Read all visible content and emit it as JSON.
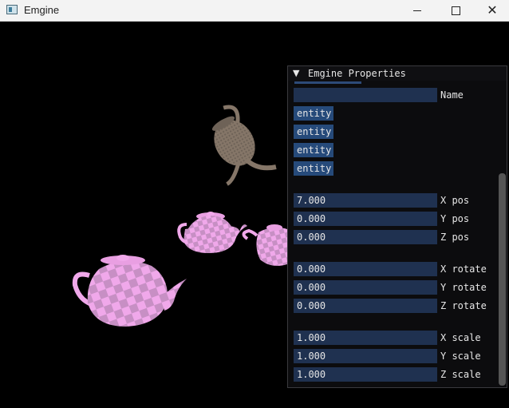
{
  "window": {
    "title": "Emgine"
  },
  "panel": {
    "title": "Emgine Properties",
    "name_label": "Name",
    "name_value": "",
    "entities": [
      "entity",
      "entity",
      "entity",
      "entity"
    ],
    "transforms": [
      {
        "label": "X pos",
        "value": "7.000"
      },
      {
        "label": "Y pos",
        "value": "0.000"
      },
      {
        "label": "Z pos",
        "value": "0.000"
      },
      {
        "label": "X rotate",
        "value": "0.000"
      },
      {
        "label": "Y rotate",
        "value": "0.000"
      },
      {
        "label": "Z rotate",
        "value": "0.000"
      },
      {
        "label": "X scale",
        "value": "1.000"
      },
      {
        "label": "Y scale",
        "value": "1.000"
      },
      {
        "label": "Z scale",
        "value": "1.000"
      }
    ]
  },
  "scene": {
    "objects": [
      "teapot-brown",
      "teapot-pink",
      "teapot-pink",
      "teapot-pink"
    ],
    "colors": {
      "pink": "#f0a8ea",
      "pink_dark": "#c78fc4",
      "brown": "#857668"
    }
  }
}
